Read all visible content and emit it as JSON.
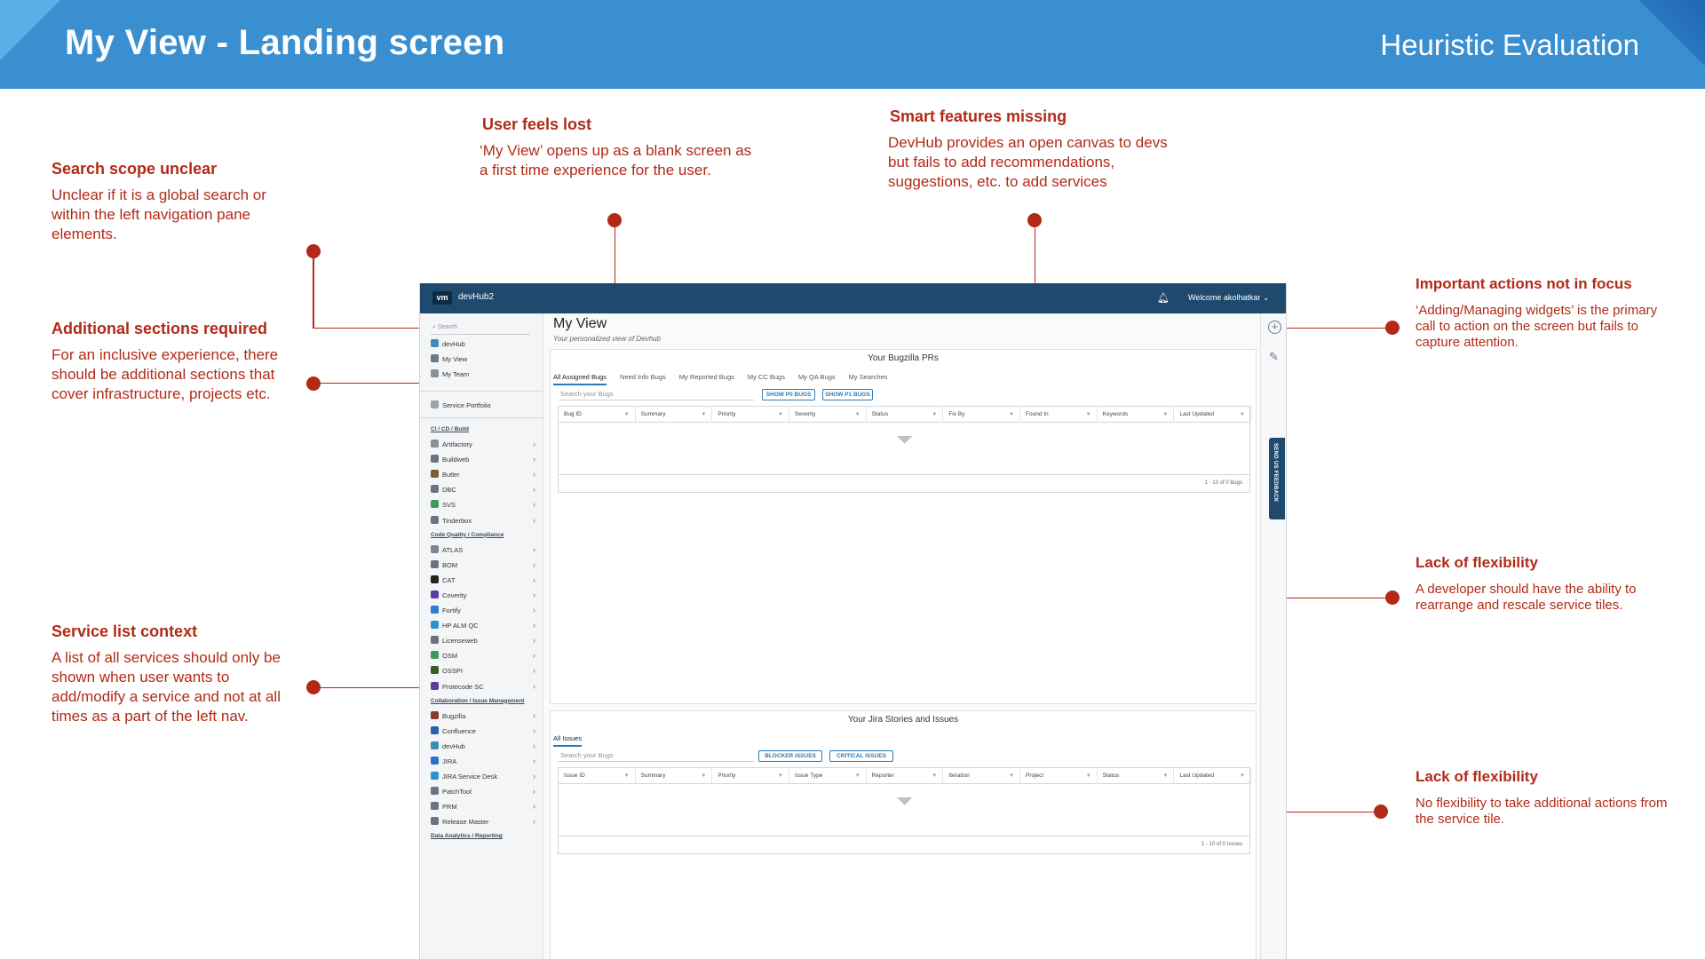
{
  "slide": {
    "title": "My View - Landing screen",
    "tag": "Heuristic Evaluation",
    "colors": {
      "header": "#3a8fd0",
      "annotation": "#b22a17"
    }
  },
  "annotations": [
    {
      "heading": "Search scope unclear",
      "body": "Unclear if it is a global search or within the left navigation pane elements."
    },
    {
      "heading": "Additional sections required",
      "body": "For an inclusive experience, there should be additional sections that cover infrastructure, projects etc."
    },
    {
      "heading": "Service list context",
      "body": "A list of all services should only be shown when user wants to add/modify a service and not at all times as a part of the left nav."
    },
    {
      "heading": "User feels lost",
      "body": "‘My View’ opens up as a blank screen as a first time experience for the user."
    },
    {
      "heading": "Smart features missing",
      "body": "DevHub provides an open canvas to devs but fails to add recommendations, suggestions, etc. to add services"
    },
    {
      "heading": "Important actions not in focus",
      "body": "‘Adding/Managing widgets’ is the primary call to action on the screen but fails to capture attention."
    },
    {
      "heading": "Lack of flexibility",
      "body": "A developer should have the ability to rearrange and rescale service tiles."
    },
    {
      "heading": "Lack of flexibility",
      "body": "No flexibility to take additional actions from the service tile."
    }
  ],
  "app": {
    "logo": "vm",
    "name": "devHub2",
    "welcome": "Welcome akolhatkar ⌄",
    "colors": {
      "topbar": "#1f4a6e",
      "accent": "#2c7bb6"
    },
    "sidebar": {
      "search_placeholder": "Search",
      "top_items": [
        "devHub",
        "My View",
        "My Team"
      ],
      "portfolio": "Service Portfolio",
      "sections": [
        {
          "title": "CI / CD / Build",
          "items": [
            "Artifactory",
            "Buildweb",
            "Butler",
            "DBC",
            "SVS",
            "Tinderbox"
          ]
        },
        {
          "title": "Code Quality / Compliance",
          "items": [
            "ATLAS",
            "BOM",
            "CAT",
            "Coverity",
            "Fortify",
            "HP ALM QC",
            "Licenseweb",
            "OSM",
            "OSSPI",
            "Protecode SC"
          ]
        },
        {
          "title": "Collaboration / Issue Management",
          "items": [
            "Bugzilla",
            "Confluence",
            "devHub",
            "JIRA",
            "JIRA Service Desk",
            "PatchTool",
            "PRM",
            "Release Master"
          ]
        },
        {
          "title": "Data Analytics / Reporting",
          "items": []
        }
      ]
    },
    "main": {
      "title": "My View",
      "subtitle": "Your personalized view of Devhub",
      "bugzilla": {
        "title": "Your Bugzilla PRs",
        "tabs": [
          "All Assigned Bugs",
          "Need Info Bugs",
          "My Reported Bugs",
          "My CC Bugs",
          "My QA Bugs",
          "My Searches"
        ],
        "search_placeholder": "Search your Bugs",
        "buttons": [
          "SHOW P0 BUGS",
          "SHOW P1 BUGS"
        ],
        "columns": [
          "Bug ID",
          "Summary",
          "Priority",
          "Severity",
          "Status",
          "Fix By",
          "Found In",
          "Keywords",
          "Last Updated"
        ],
        "footer": "1 - 10 of 0 Bugs"
      },
      "jira": {
        "title": "Your Jira Stories and Issues",
        "tabs": [
          "All Issues"
        ],
        "search_placeholder": "Search your Bugs",
        "buttons": [
          "BLOCKER ISSUES",
          "CRITICAL ISSUES"
        ],
        "columns": [
          "Issue ID",
          "Summary",
          "Priority",
          "Issue Type",
          "Reporter",
          "Iteration",
          "Project",
          "Status",
          "Last Updated"
        ],
        "footer": "1 - 10 of 0 Issues"
      }
    },
    "rail": {
      "add_icon": "plus-circle-icon",
      "edit_icon": "edit-icon",
      "feedback": "SEND US FEEDBACK"
    }
  }
}
